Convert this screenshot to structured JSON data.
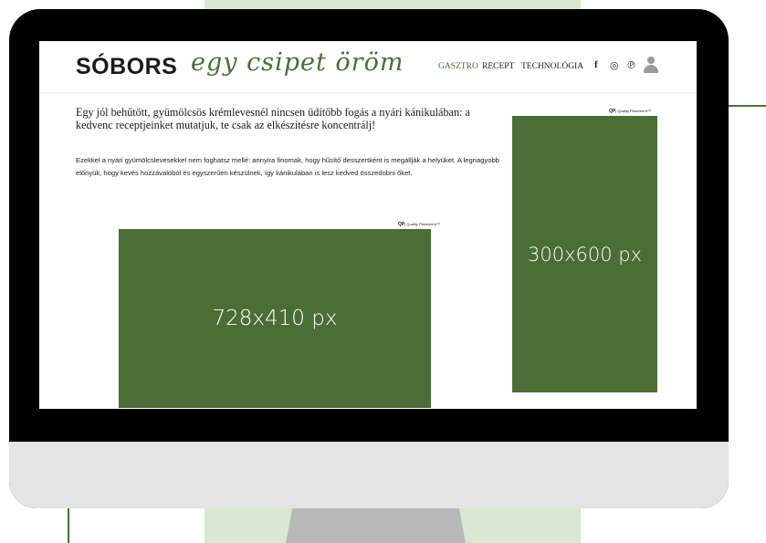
{
  "site": {
    "logo": "SÓBORS",
    "tagline": "egy csipet öröm"
  },
  "nav": {
    "items": [
      {
        "label": "GASZTRO",
        "active": true
      },
      {
        "label": "RECEPT",
        "active": false
      },
      {
        "label": "TECHNOLÓGIA",
        "active": false
      }
    ]
  },
  "social": {
    "facebook_icon": "f",
    "instagram_icon": "◎",
    "pinterest_icon": "℗"
  },
  "article": {
    "headline": "Egy jól behűtött, gyümölcsös krémlevesnél nincsen üdítőbb fogás a nyári kánikulában: a kedvenc receptjeinket mutatjuk, te csak az elkészítésre koncentrálj!",
    "body": "Ezekkel a nyári gyümölcslevesekkel nem foghatsz mellé: annyira finomak, hogy hűsítő desszertként is megállják a helyüket. A legnagyobb előnyük, hogy kevés hozzávalóból és egyszerűen készülnek, így kánikulában is lesz kedved összedobni őket."
  },
  "ads": {
    "main": {
      "label": "728x410 px",
      "badge_mark": "QP",
      "badge_text": "| Quality Placement™"
    },
    "side": {
      "label": "300x600 px",
      "badge_mark": "QP",
      "badge_text": "| Quality Placement™"
    }
  },
  "colors": {
    "brand_green": "#4a6e35",
    "panel_green": "#d9e7d3"
  }
}
